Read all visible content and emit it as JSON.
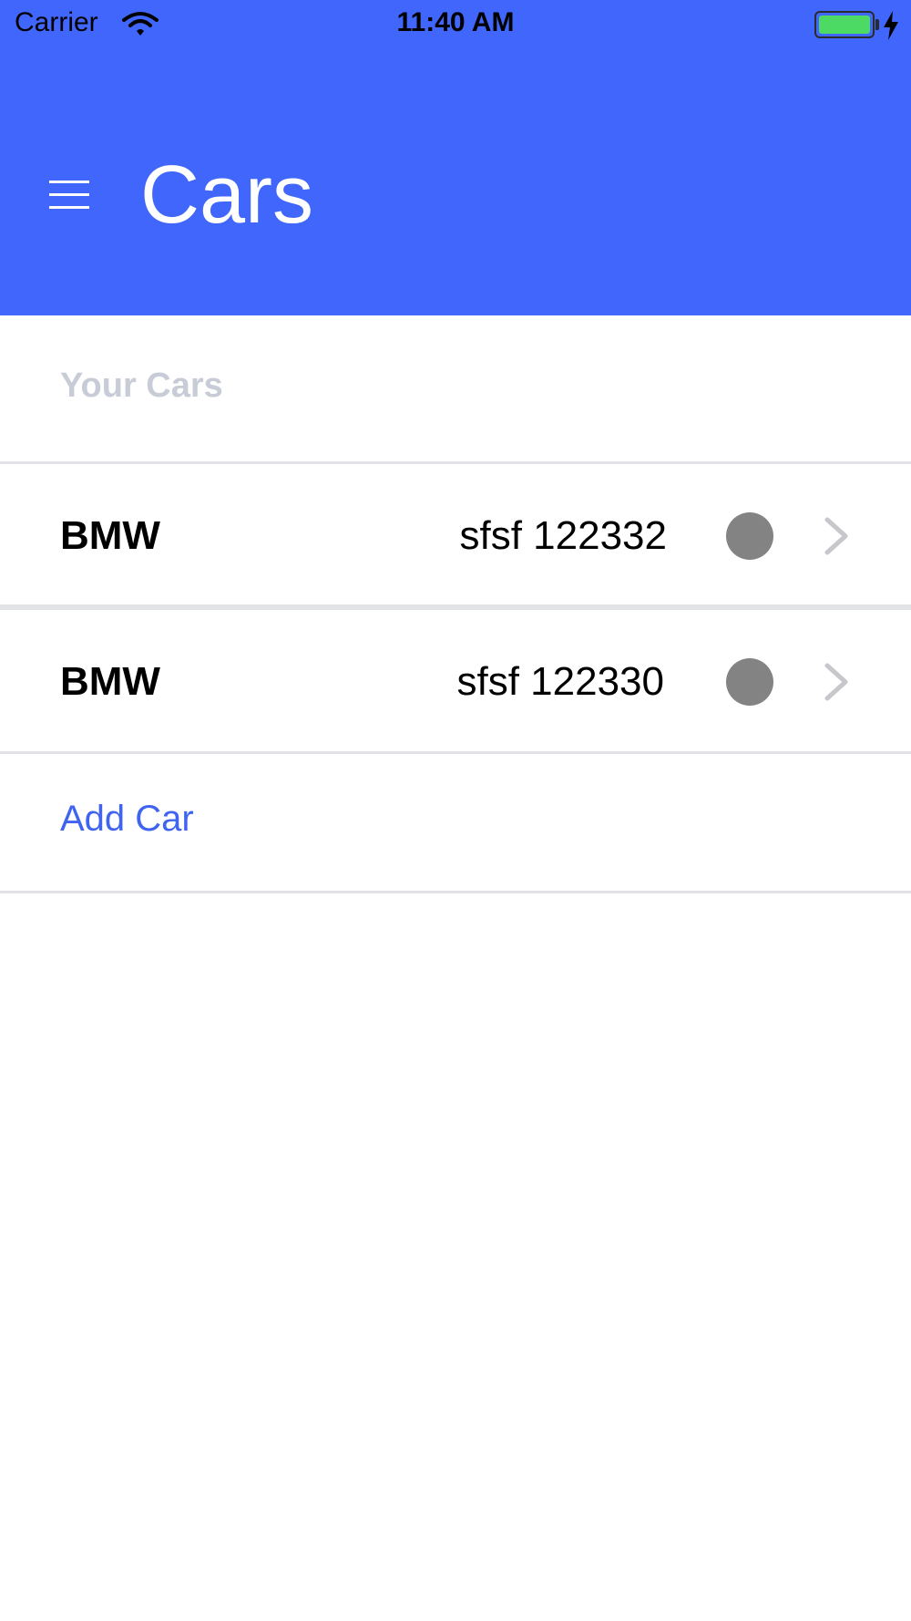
{
  "status_bar": {
    "carrier": "Carrier",
    "time": "11:40 AM",
    "icons": [
      "wifi-icon",
      "battery-icon",
      "charging-bolt-icon"
    ],
    "battery_color": "#4cd964"
  },
  "header": {
    "title": "Cars",
    "menu_icon": "hamburger-menu-icon",
    "background_color": "#4066fc"
  },
  "cars_section": {
    "label": "Your Cars",
    "items": [
      {
        "make": "BMW",
        "plate": "sfsf 122332",
        "status_color": "#838383",
        "icon": "chevron-right-icon"
      },
      {
        "make": "BMW",
        "plate": "sfsf 122330",
        "status_color": "#838383",
        "icon": "chevron-right-icon"
      }
    ],
    "add_label": "Add Car",
    "add_color": "#3f64f1"
  }
}
